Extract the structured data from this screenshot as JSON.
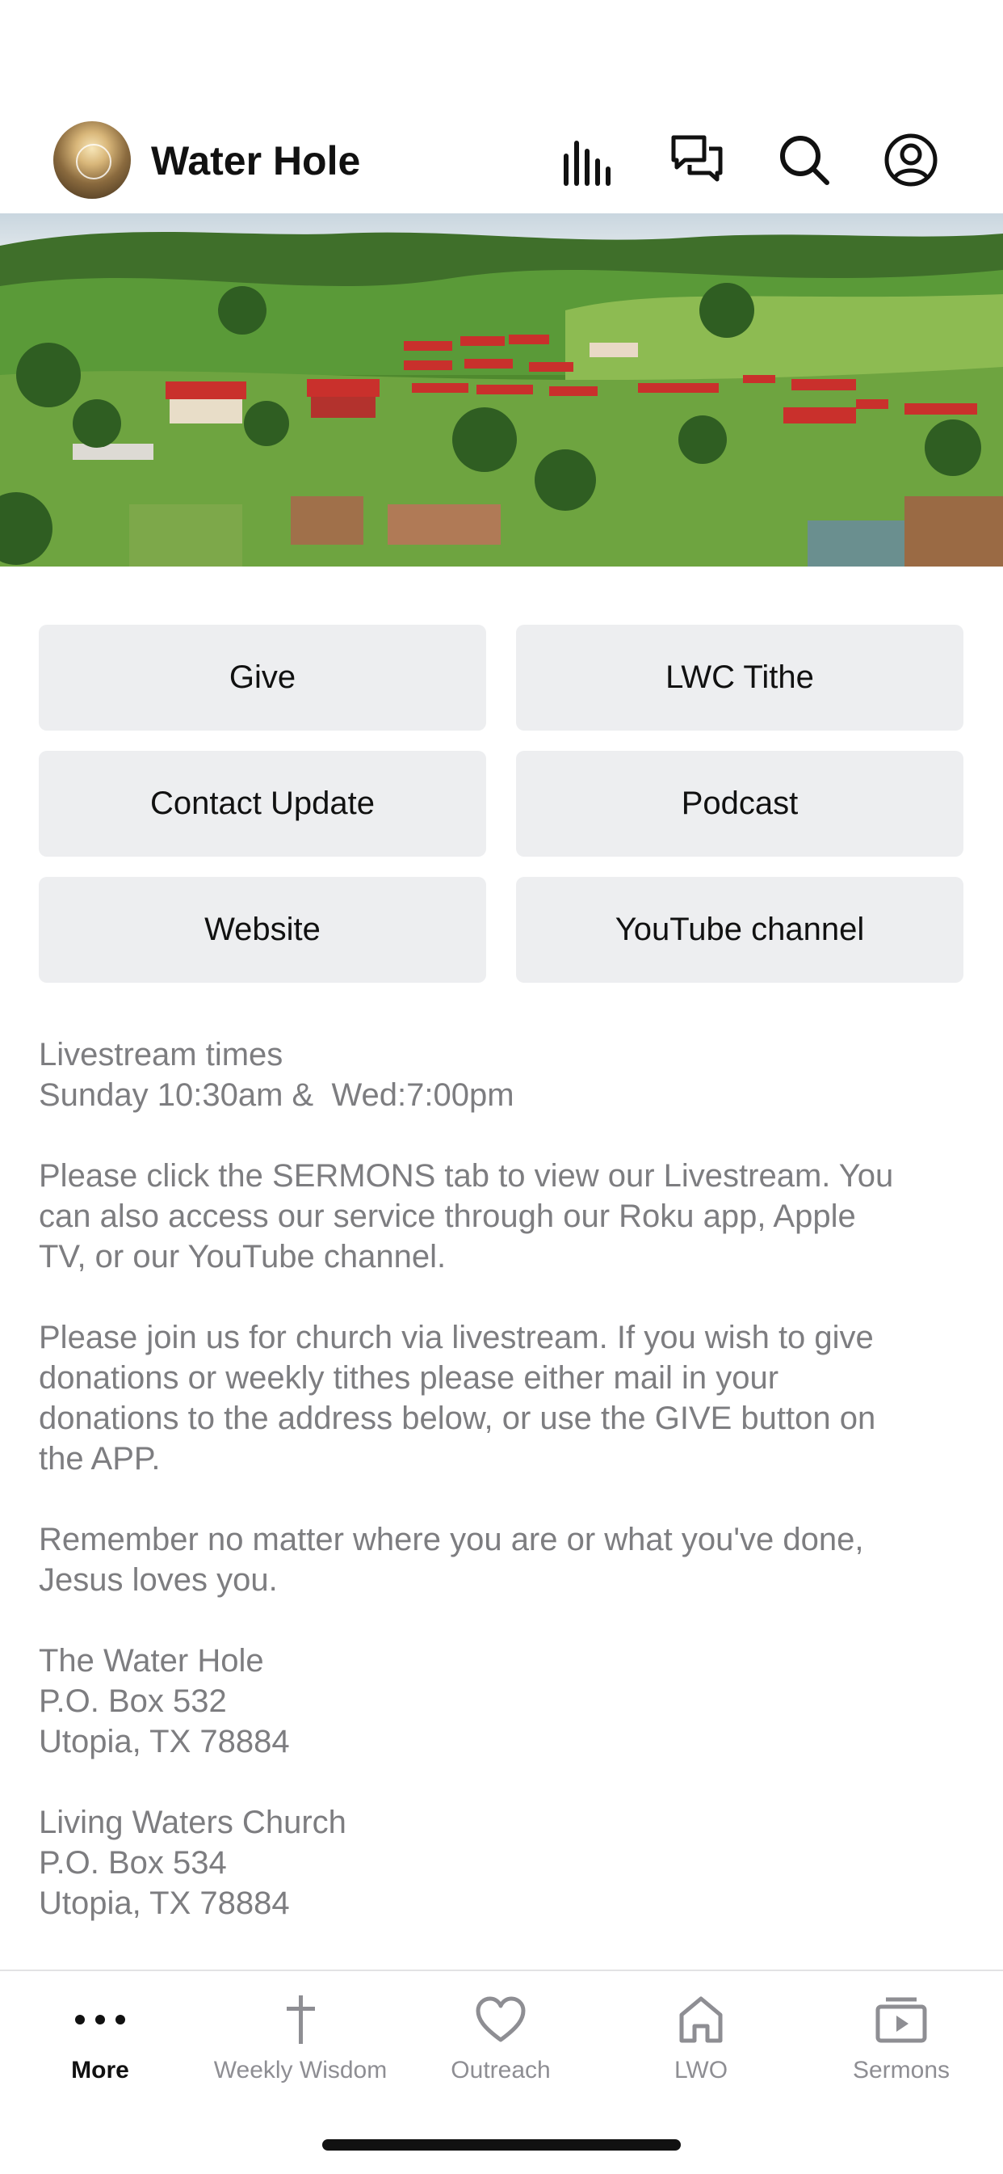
{
  "app": {
    "title": "Water Hole"
  },
  "header": {
    "icons": [
      "audio-bars-icon",
      "chat-icon",
      "search-icon",
      "profile-icon"
    ]
  },
  "buttons": [
    {
      "label": "Give"
    },
    {
      "label": "LWC Tithe"
    },
    {
      "label": "Contact Update"
    },
    {
      "label": "Podcast"
    },
    {
      "label": "Website"
    },
    {
      "label": "YouTube channel"
    }
  ],
  "content": {
    "livestream": {
      "line1": "Livestream times",
      "line2": "Sunday 10:30am &  Wed:7:00pm"
    },
    "sermons_note": {
      "line1": "Please click the SERMONS tab to view our Livestream. You",
      "line2": "can also access our service through our Roku app, Apple",
      "line3": "TV, or our YouTube channel."
    },
    "donations_note": {
      "line1": "Please join us for church via livestream. If you wish to give",
      "line2": "donations or weekly tithes please either mail in your",
      "line3": "donations to the address below, or use the GIVE button on",
      "line4": "the APP."
    },
    "remember": {
      "line1": "Remember no matter where you are or what you've done,",
      "line2": "Jesus loves you."
    },
    "address1": {
      "name": "The Water Hole",
      "box": "P.O. Box 532",
      "city": "Utopia, TX 78884"
    },
    "address2": {
      "name": "Living Waters Church",
      "box": "P.O. Box 534",
      "city": "Utopia, TX 78884"
    }
  },
  "tabbar": {
    "items": [
      {
        "label": "More",
        "icon": "more-dots-icon",
        "active": true
      },
      {
        "label": "Weekly Wisdom",
        "icon": "cross-icon",
        "active": false
      },
      {
        "label": "Outreach",
        "icon": "heart-icon",
        "active": false
      },
      {
        "label": "LWO",
        "icon": "home-icon",
        "active": false
      },
      {
        "label": "Sermons",
        "icon": "video-play-icon",
        "active": false
      }
    ]
  },
  "colors": {
    "button_bg": "#edeef0",
    "body_text": "#7d7d80",
    "tab_inactive": "#8e8e93",
    "tab_active": "#111111"
  }
}
